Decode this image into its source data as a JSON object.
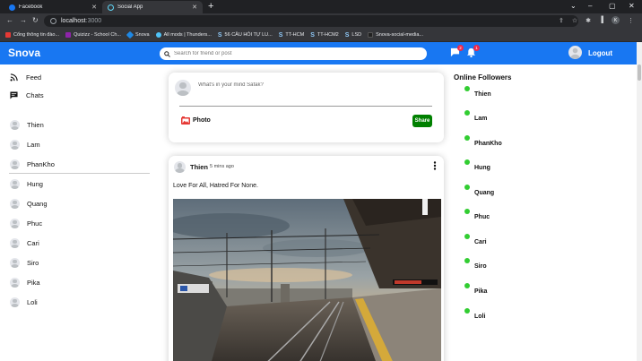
{
  "browser": {
    "tabs": [
      {
        "title": "Facebook",
        "active": false,
        "favicon_color": "#1877f2"
      },
      {
        "title": "Social App",
        "active": true,
        "favicon_color": "#61dafb"
      }
    ],
    "address": {
      "host": "localhost",
      "port": ":3000"
    },
    "bookmarks": [
      {
        "label": "Cổng thông tin đào...",
        "color": "#e53935"
      },
      {
        "label": "Quizizz - School Ch...",
        "color": "#8e24aa"
      },
      {
        "label": "Snova",
        "color": "#1e88e5"
      },
      {
        "label": "All mods | Thunders...",
        "color": "#4fc3f7"
      },
      {
        "label": "56 CÂU HỎI TỰ LU...",
        "color": "#90caf9"
      },
      {
        "label": "TT-HCM",
        "color": "#90caf9"
      },
      {
        "label": "TT-HCM2",
        "color": "#90caf9"
      },
      {
        "label": "LSD",
        "color": "#90caf9"
      },
      {
        "label": "Snova-social-media...",
        "color": "#212121"
      }
    ],
    "profile_initial": "K"
  },
  "header": {
    "logo": "Snova",
    "search_placeholder": "Search for friend or post",
    "chat_badge": "2",
    "notification_badge": "1",
    "logout": "Logout",
    "accent": "#1877f2"
  },
  "sidebar": {
    "links": [
      {
        "label": "Feed",
        "icon": "rss-icon"
      },
      {
        "label": "Chats",
        "icon": "chat-icon"
      }
    ],
    "friends": [
      "Thien",
      "Lam",
      "PhanKho",
      "Hung",
      "Quang",
      "Phuc",
      "Cari",
      "Siro",
      "Pika",
      "Loli"
    ]
  },
  "share": {
    "placeholder": "What's in your mind Safak?",
    "photo_label": "Photo",
    "share_button": "Share"
  },
  "post": {
    "username": "Thien",
    "time": "5 mins ago",
    "text": "Love For All, Hatred For None."
  },
  "rightbar": {
    "title": "Online Followers",
    "followers": [
      "Thien",
      "Lam",
      "PhanKho",
      "Hung",
      "Quang",
      "Phuc",
      "Cari",
      "Siro",
      "Pika",
      "Loli"
    ],
    "online_color": "#32cd32"
  }
}
